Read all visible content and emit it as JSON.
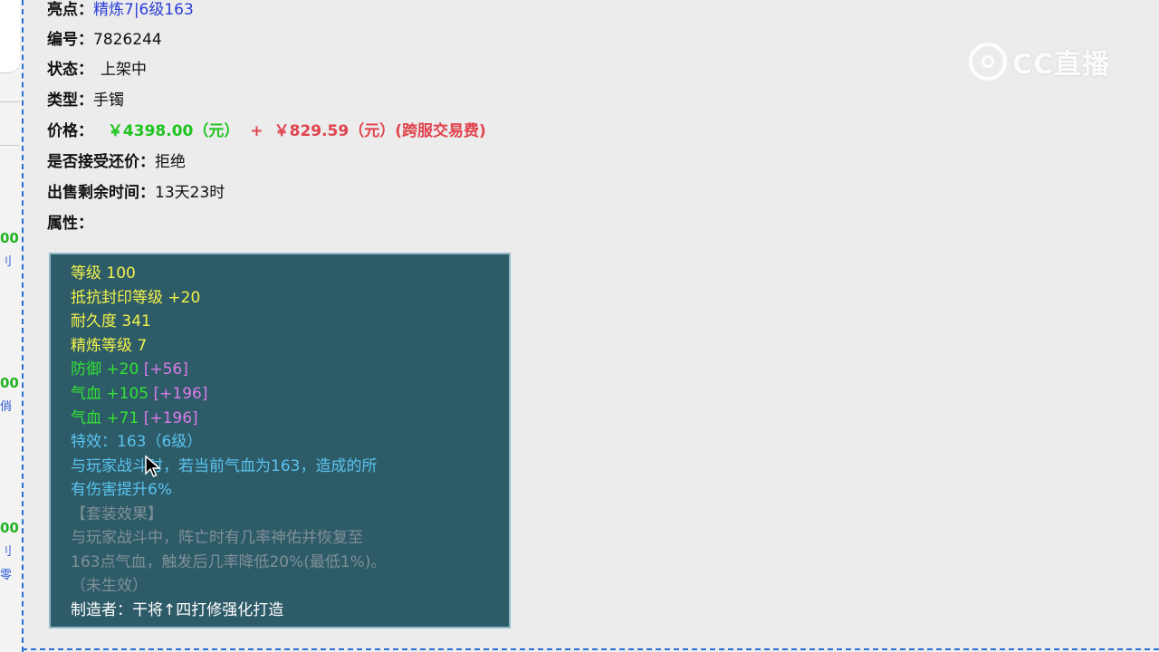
{
  "sidebar_fragments": {
    "frag_1": "00",
    "frag_2": "刂",
    "frag_3": "00",
    "frag_4": "俏",
    "frag_5": "00",
    "frag_6": "刂",
    "frag_7": "零"
  },
  "item": {
    "highlight_label": "亮点：",
    "highlight_value": "精炼7|6级163",
    "id_label": "编号：",
    "id_value": "7826244",
    "status_label": "状态：",
    "status_value": "上架中",
    "type_label": "类型：",
    "type_value": "手镯",
    "price_label": "价格：",
    "price_value": "￥4398.00（元）",
    "price_plus": "+",
    "fee_value": "￥829.59（元）(跨服交易费)",
    "counter_label": "是否接受还价：",
    "counter_value": "拒绝",
    "time_label": "出售剩余时间：",
    "time_value": "13天23时",
    "attr_label": "属性："
  },
  "tooltip": {
    "level": "等级 100",
    "seal_resist": "抵抗封印等级 +20",
    "durability": "耐久度 341",
    "refine": "精炼等级 7",
    "defense": "防御 +20",
    "defense_bonus": "[+56]",
    "hp1": "气血 +105",
    "hp1_bonus": "[+196]",
    "hp2": "气血 +71",
    "hp2_bonus": "[+196]",
    "special": "特效：163（6级）",
    "special_desc_1": "与玩家战斗时，若当前气血为163，造成的所",
    "special_desc_2": "有伤害提升6%",
    "set_title": "【套装效果】",
    "set_desc_1": "与玩家战斗中，阵亡时有几率神佑并恢复至",
    "set_desc_2": "163点气血，触发后几率降低20%(最低1%)。",
    "set_state": "（未生效）",
    "maker": "制造者：干将↑四打修强化打造"
  },
  "watermark": {
    "icon": "cc-logo-icon",
    "text": "CC直播"
  },
  "colors": {
    "tooltip_bg": "#2e5b68",
    "price_green": "#1fc41f",
    "fee_red": "#e0444e",
    "link_blue": "#2a3ed6"
  }
}
